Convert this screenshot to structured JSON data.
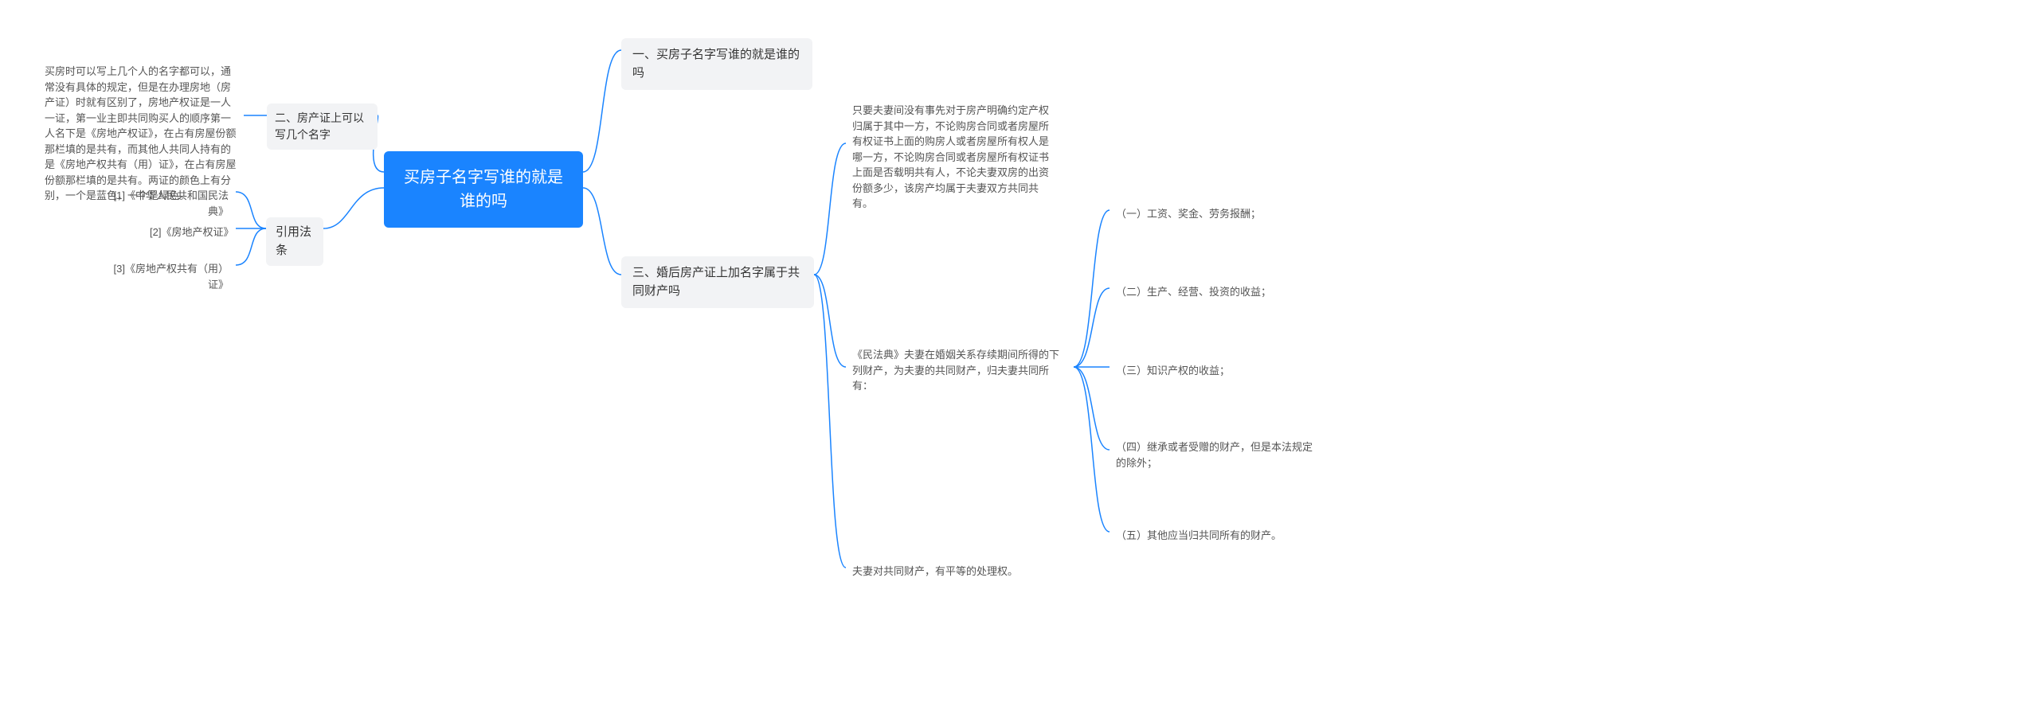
{
  "root": {
    "title": "买房子名字写谁的就是谁的吗"
  },
  "left": {
    "b1": {
      "label": "二、房产证上可以写几个名字",
      "desc": "买房时可以写上几个人的名字都可以，通常没有具体的规定，但是在办理房地（房产证）时就有区别了，房地产权证是一人一证，第一业主即共同购买人的顺序第一人名下是《房地产权证》，在占有房屋份额那栏填的是共有，而其他人共同人持有的是《房地产权共有（用）证》，在占有房屋份额那栏填的是共有。两证的颜色上有分别，一个是蓝色，一个是绿色。"
    },
    "b2": {
      "label": "引用法条",
      "items": [
        "[1]《中华人民共和国民法典》",
        "[2]《房地产权证》",
        "[3]《房地产权共有（用）证》"
      ]
    }
  },
  "right": {
    "b1": {
      "label": "一、买房子名字写谁的就是谁的吗"
    },
    "b2": {
      "label": "三、婚后房产证上加名字属于共同财产吗",
      "child1": "只要夫妻间没有事先对于房产明确约定产权归属于其中一方，不论购房合同或者房屋所有权证书上面的购房人或者房屋所有权人是哪一方，不论购房合同或者房屋所有权证书上面是否载明共有人，不论夫妻双房的出资份额多少，该房产均属于夫妻双方共同共有。",
      "child2": {
        "label": "《民法典》夫妻在婚姻关系存续期间所得的下列财产，为夫妻的共同财产，归夫妻共同所有：",
        "items": [
          "（一）工资、奖金、劳务报酬；",
          "（二）生产、经营、投资的收益；",
          "（三）知识产权的收益；",
          "（四）继承或者受赠的财产，但是本法规定的除外；",
          "（五）其他应当归共同所有的财产。"
        ]
      },
      "child3": "夫妻对共同财产，有平等的处理权。"
    }
  }
}
